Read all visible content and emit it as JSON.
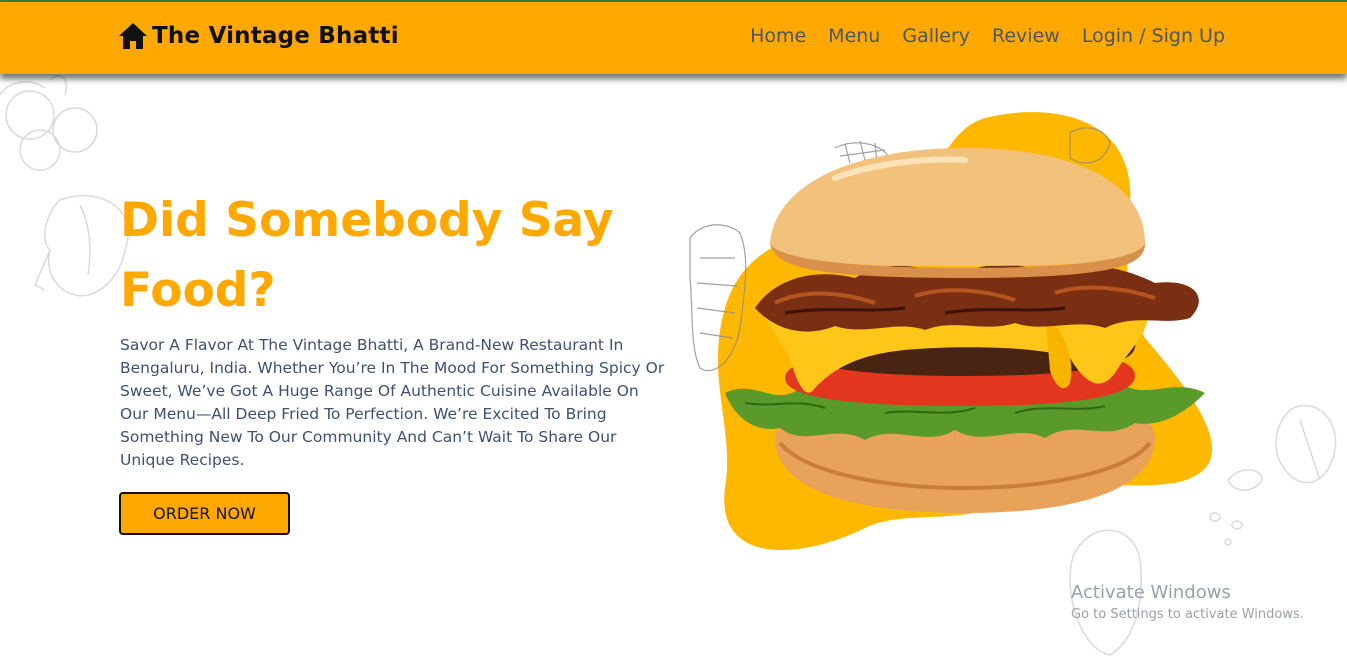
{
  "brand": {
    "name": "The Vintage Bhatti",
    "icon": "home-icon"
  },
  "nav": {
    "items": [
      {
        "label": "Home"
      },
      {
        "label": "Menu"
      },
      {
        "label": "Gallery"
      },
      {
        "label": "Review"
      },
      {
        "label": "Login / Sign Up"
      }
    ]
  },
  "hero": {
    "title_line1": "Did Somebody Say",
    "title_line2": "Food?",
    "description": "Savor A Flavor At The Vintage Bhatti, A Brand-New Restaurant In Bengaluru, India. Whether You’re In The Mood For Something Spicy Or Sweet, We’ve Got A Huge Range Of Authentic Cuisine Available On Our Menu—All Deep Fried To Perfection. We’re Excited To Bring Something New To Our Community And Can’t Wait To Share Our Unique Recipes.",
    "cta_label": "ORDER NOW"
  },
  "watermark": {
    "title": "Activate Windows",
    "subtitle": "Go to Settings to activate Windows."
  },
  "colors": {
    "accent": "#ffa800",
    "text_body": "#3f5072",
    "nav_text": "#4b5563"
  }
}
